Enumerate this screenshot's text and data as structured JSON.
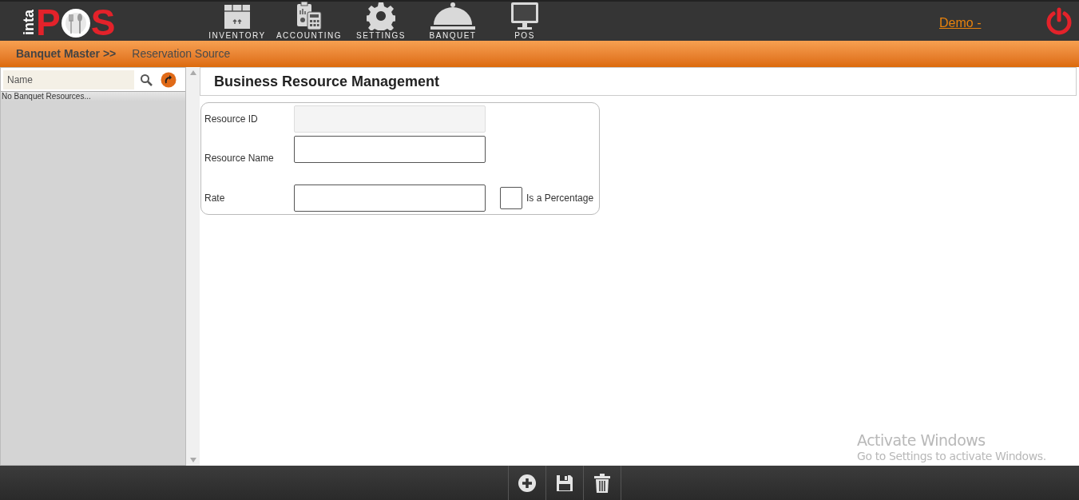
{
  "logo": {
    "prefix": "inta",
    "first_letter": "P",
    "last_letter": "S"
  },
  "nav": [
    {
      "kind": "box",
      "label": "INVENTORY"
    },
    {
      "kind": "calculator",
      "label": "ACCOUNTING"
    },
    {
      "kind": "gear",
      "label": "SETTINGS"
    },
    {
      "kind": "cloche",
      "label": "BANQUET"
    },
    {
      "kind": "monitor",
      "label": "POS"
    }
  ],
  "user_link": "Demo -",
  "breadcrumb": {
    "parent": "Banquet Master >>",
    "current": "Reservation Source"
  },
  "sidebar": {
    "search": {
      "placeholder": "Name"
    },
    "empty_text": "No Banquet Resources..."
  },
  "form": {
    "title": "Business Resource Management",
    "fields": [
      {
        "label": "Resource ID",
        "disabled": true
      },
      {
        "label": "Resource Name",
        "disabled": false
      },
      {
        "label": "Rate",
        "disabled": false
      }
    ],
    "checkbox": {
      "label": "Is a Percentage",
      "checked": false
    }
  },
  "toolbar": [
    {
      "kind": "add"
    },
    {
      "kind": "save"
    },
    {
      "kind": "delete"
    }
  ],
  "os_notice": {
    "title": "Activate Windows",
    "text": "Go to Settings to activate Windows."
  }
}
